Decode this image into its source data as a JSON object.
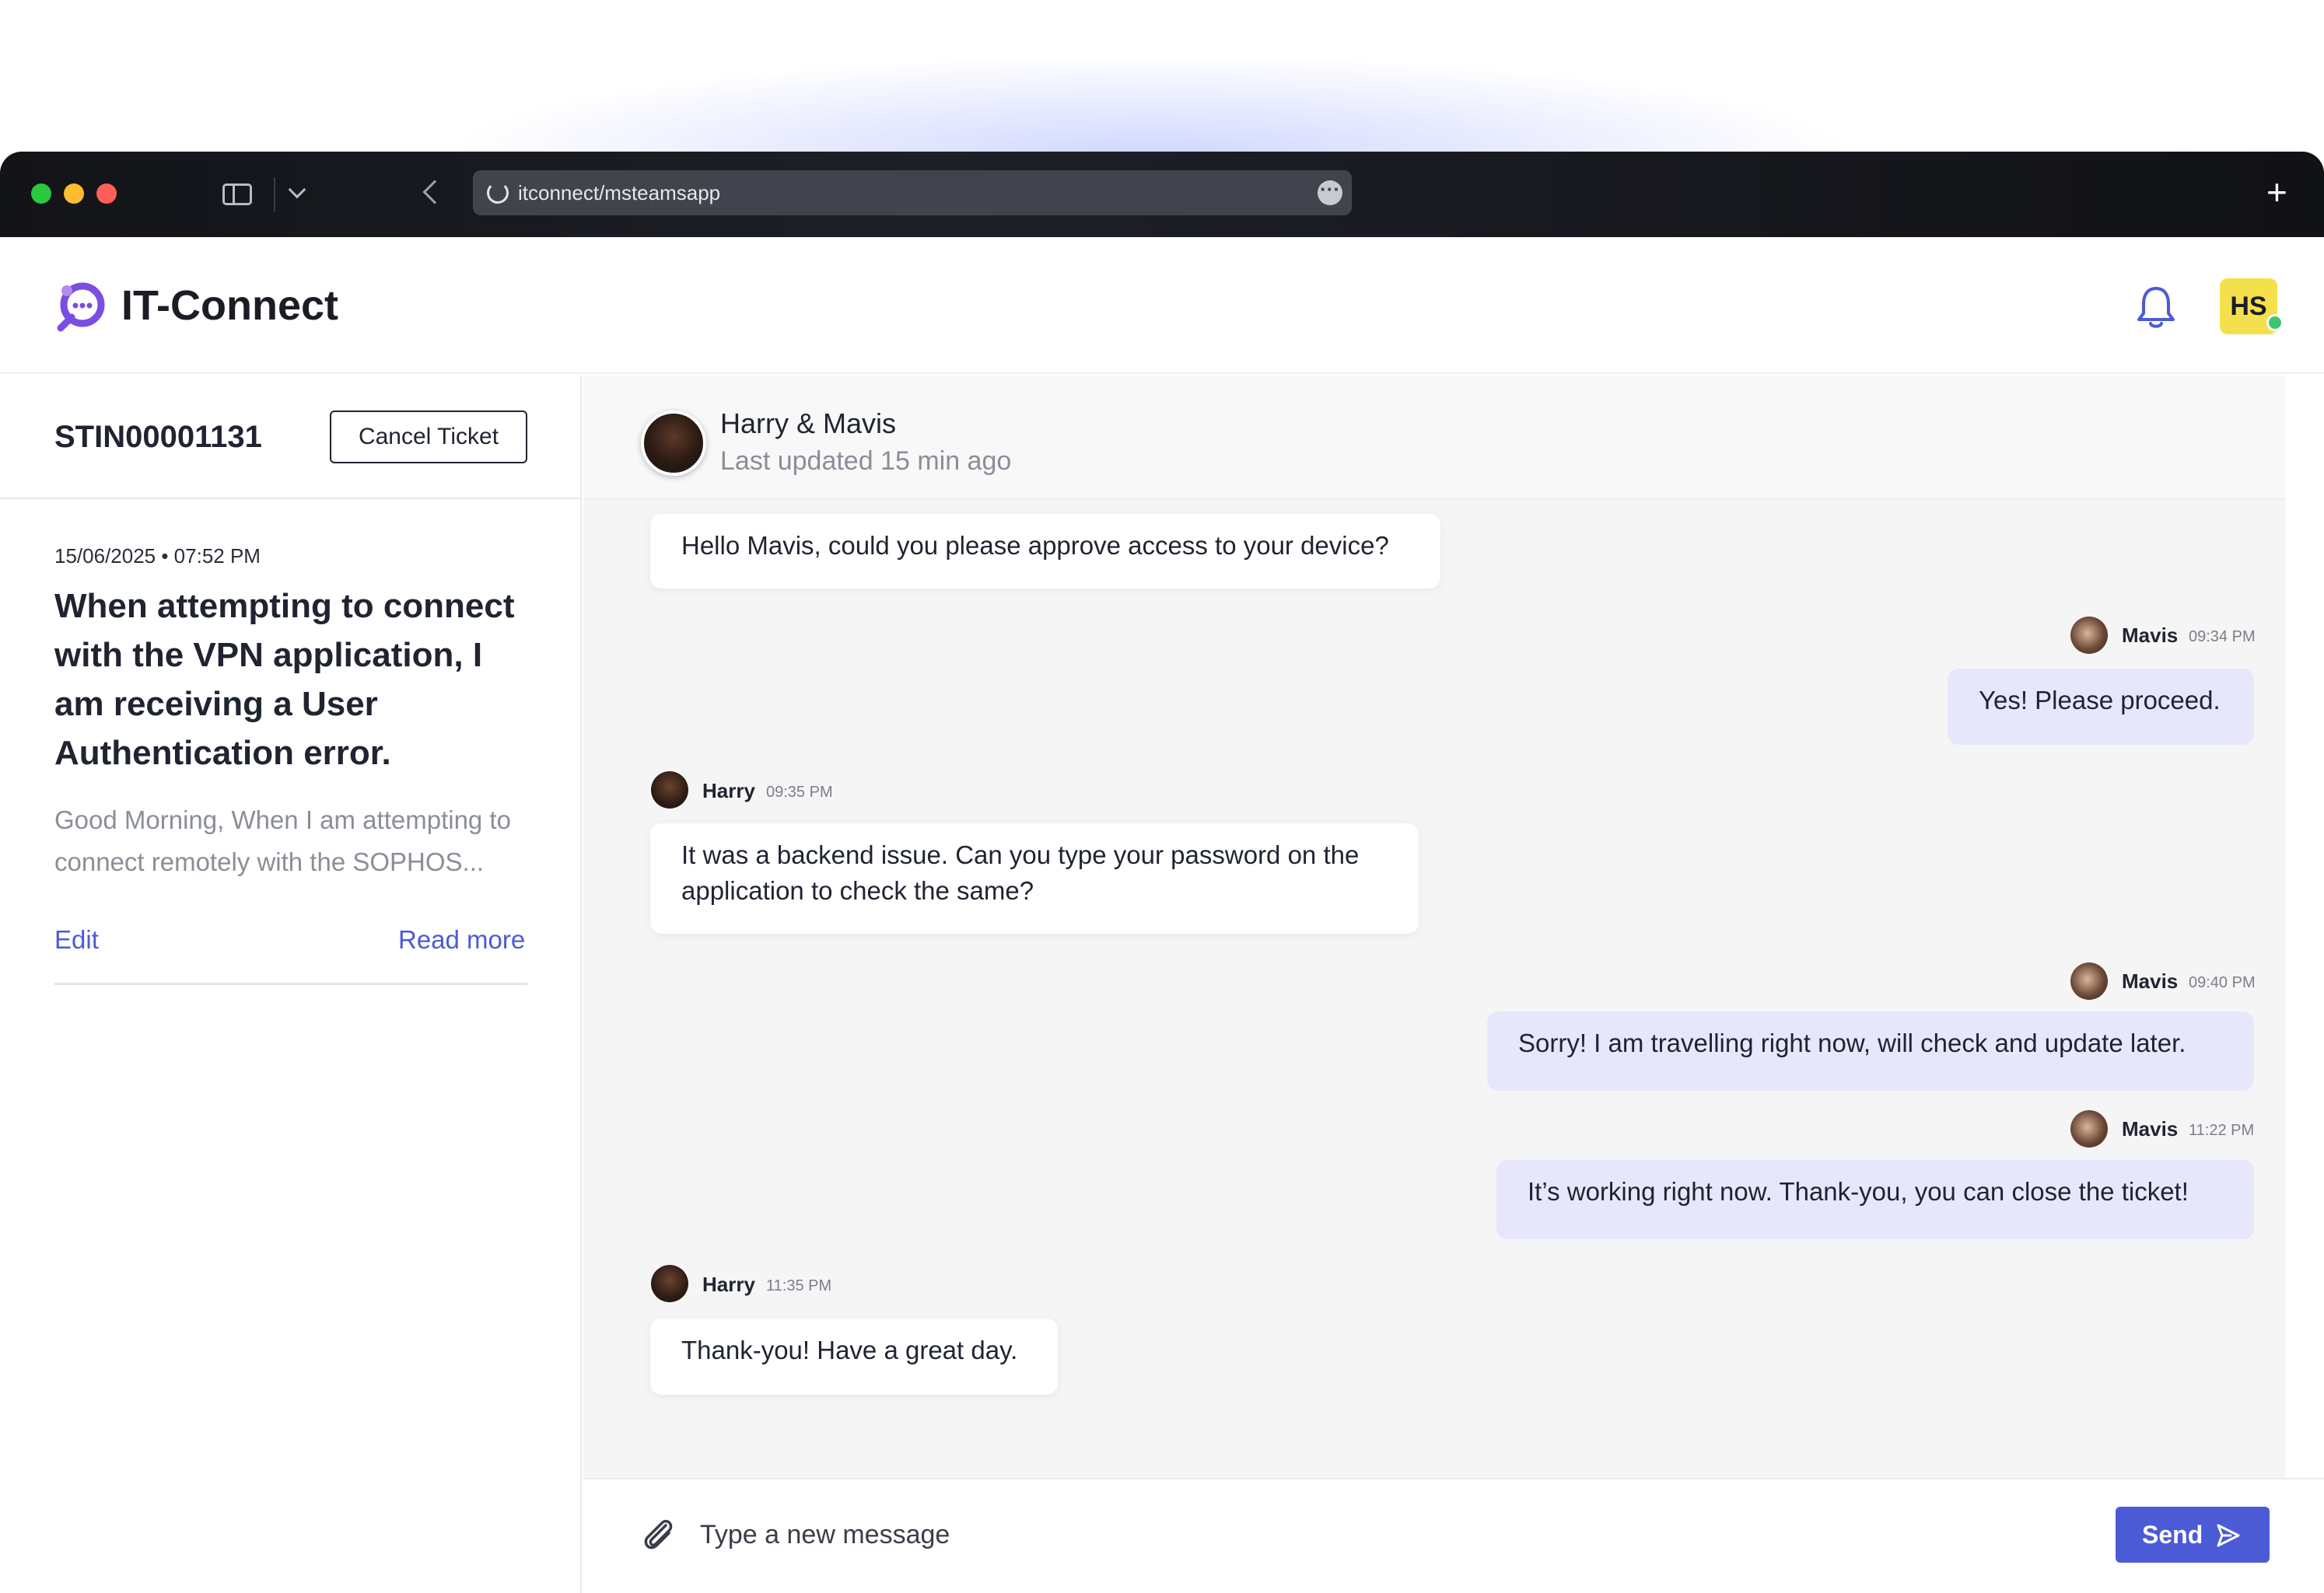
{
  "browser": {
    "url": "itconnect/msteamsapp",
    "new_tab_label": "+"
  },
  "app": {
    "name": "IT-Connect",
    "user_initials": "HS",
    "colors": {
      "accent": "#4b5bd6",
      "logo": "#7b4de0",
      "avatar": "#f4e04d",
      "online": "#3fc56c"
    }
  },
  "ticket": {
    "id": "STIN00001131",
    "cancel_label": "Cancel Ticket",
    "date": "15/06/2025 • 07:52 PM",
    "title": "When attempting to connect with the VPN application, I am receiving a User Authentication error.",
    "description": "Good Morning,  When I am attempting to connect remotely with the SOPHOS...",
    "edit_label": "Edit",
    "read_more_label": "Read more"
  },
  "chat": {
    "title": "Harry & Mavis",
    "subtitle": "Last updated 15 min ago",
    "messages": [
      {
        "text": "Hello Mavis, could you please approve access to your device?"
      },
      {
        "sender": "Mavis",
        "time": "09:34 PM",
        "text": "Yes! Please proceed."
      },
      {
        "sender": "Harry",
        "time": "09:35 PM",
        "text": "It was a backend issue. Can you type your password on the application to check the same?"
      },
      {
        "sender": "Mavis",
        "time": "09:40 PM",
        "text": "Sorry! I am travelling right now, will check and update later."
      },
      {
        "sender": "Mavis",
        "time": "11:22 PM",
        "text": "It’s working right now. Thank-you, you can close the ticket!"
      },
      {
        "sender": "Harry",
        "time": "11:35 PM",
        "text": "Thank-you! Have a great day."
      }
    ]
  },
  "composer": {
    "placeholder": "Type a new message",
    "send_label": "Send"
  },
  "icons": [
    "sidebar-toggle-icon",
    "chevron-down-icon",
    "back-arrow-icon",
    "site-settings-icon",
    "more-icon",
    "plus-icon",
    "logo-icon",
    "bell-icon",
    "paperclip-icon",
    "send-icon"
  ]
}
